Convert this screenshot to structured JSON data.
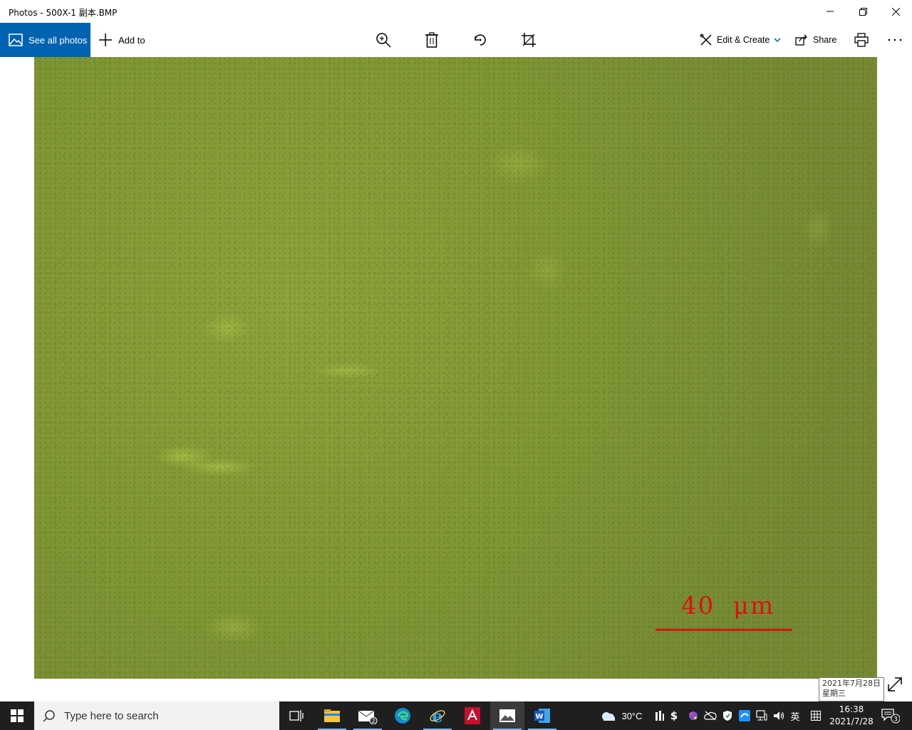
{
  "window": {
    "title": "Photos - 500X-1 副本.BMP"
  },
  "toolbar": {
    "see_all_label": "See all photos",
    "add_to_label": "Add to",
    "edit_create_label": "Edit & Create",
    "share_label": "Share"
  },
  "photo": {
    "scale_label": "40  μm",
    "scale_color": "#e01010"
  },
  "tooltip": {
    "date": "2021年7月28日",
    "weekday": "星期三"
  },
  "taskbar": {
    "search_placeholder": "Type here to search",
    "mail_badge": "2",
    "weather": "30°C",
    "ime": "英",
    "time": "16:38",
    "date": "2021/7/28",
    "notification_count": "3"
  },
  "colors": {
    "accent": "#0063b1",
    "taskbar": "#1f1f1f"
  }
}
